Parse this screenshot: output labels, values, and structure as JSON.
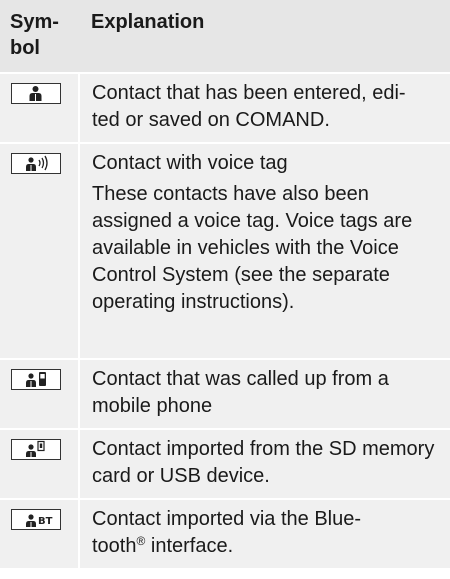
{
  "table": {
    "header": {
      "symbol": "Sym-\nbol",
      "explanation": "Explanation"
    },
    "rows": [
      {
        "icon": "contact-icon",
        "lines": [
          "Contact that has been entered, edi-\nted or saved on COMAND."
        ]
      },
      {
        "icon": "contact-voice-tag-icon",
        "lines": [
          "Contact with voice tag",
          "These contacts have also been assigned a voice tag. Voice tags are available in vehicles with the Voice Control System (see the separate operating instructions)."
        ]
      },
      {
        "icon": "contact-mobile-phone-icon",
        "lines": [
          "Contact that was called up from a mobile phone"
        ]
      },
      {
        "icon": "contact-sd-card-icon",
        "lines": [
          "Contact imported from the SD memory card or USB device."
        ]
      },
      {
        "icon": "contact-bluetooth-icon",
        "icon_text": "BT",
        "lines": [
          "Contact imported via the Blue-\ntooth",
          "interface."
        ],
        "superscript": "®"
      }
    ]
  }
}
